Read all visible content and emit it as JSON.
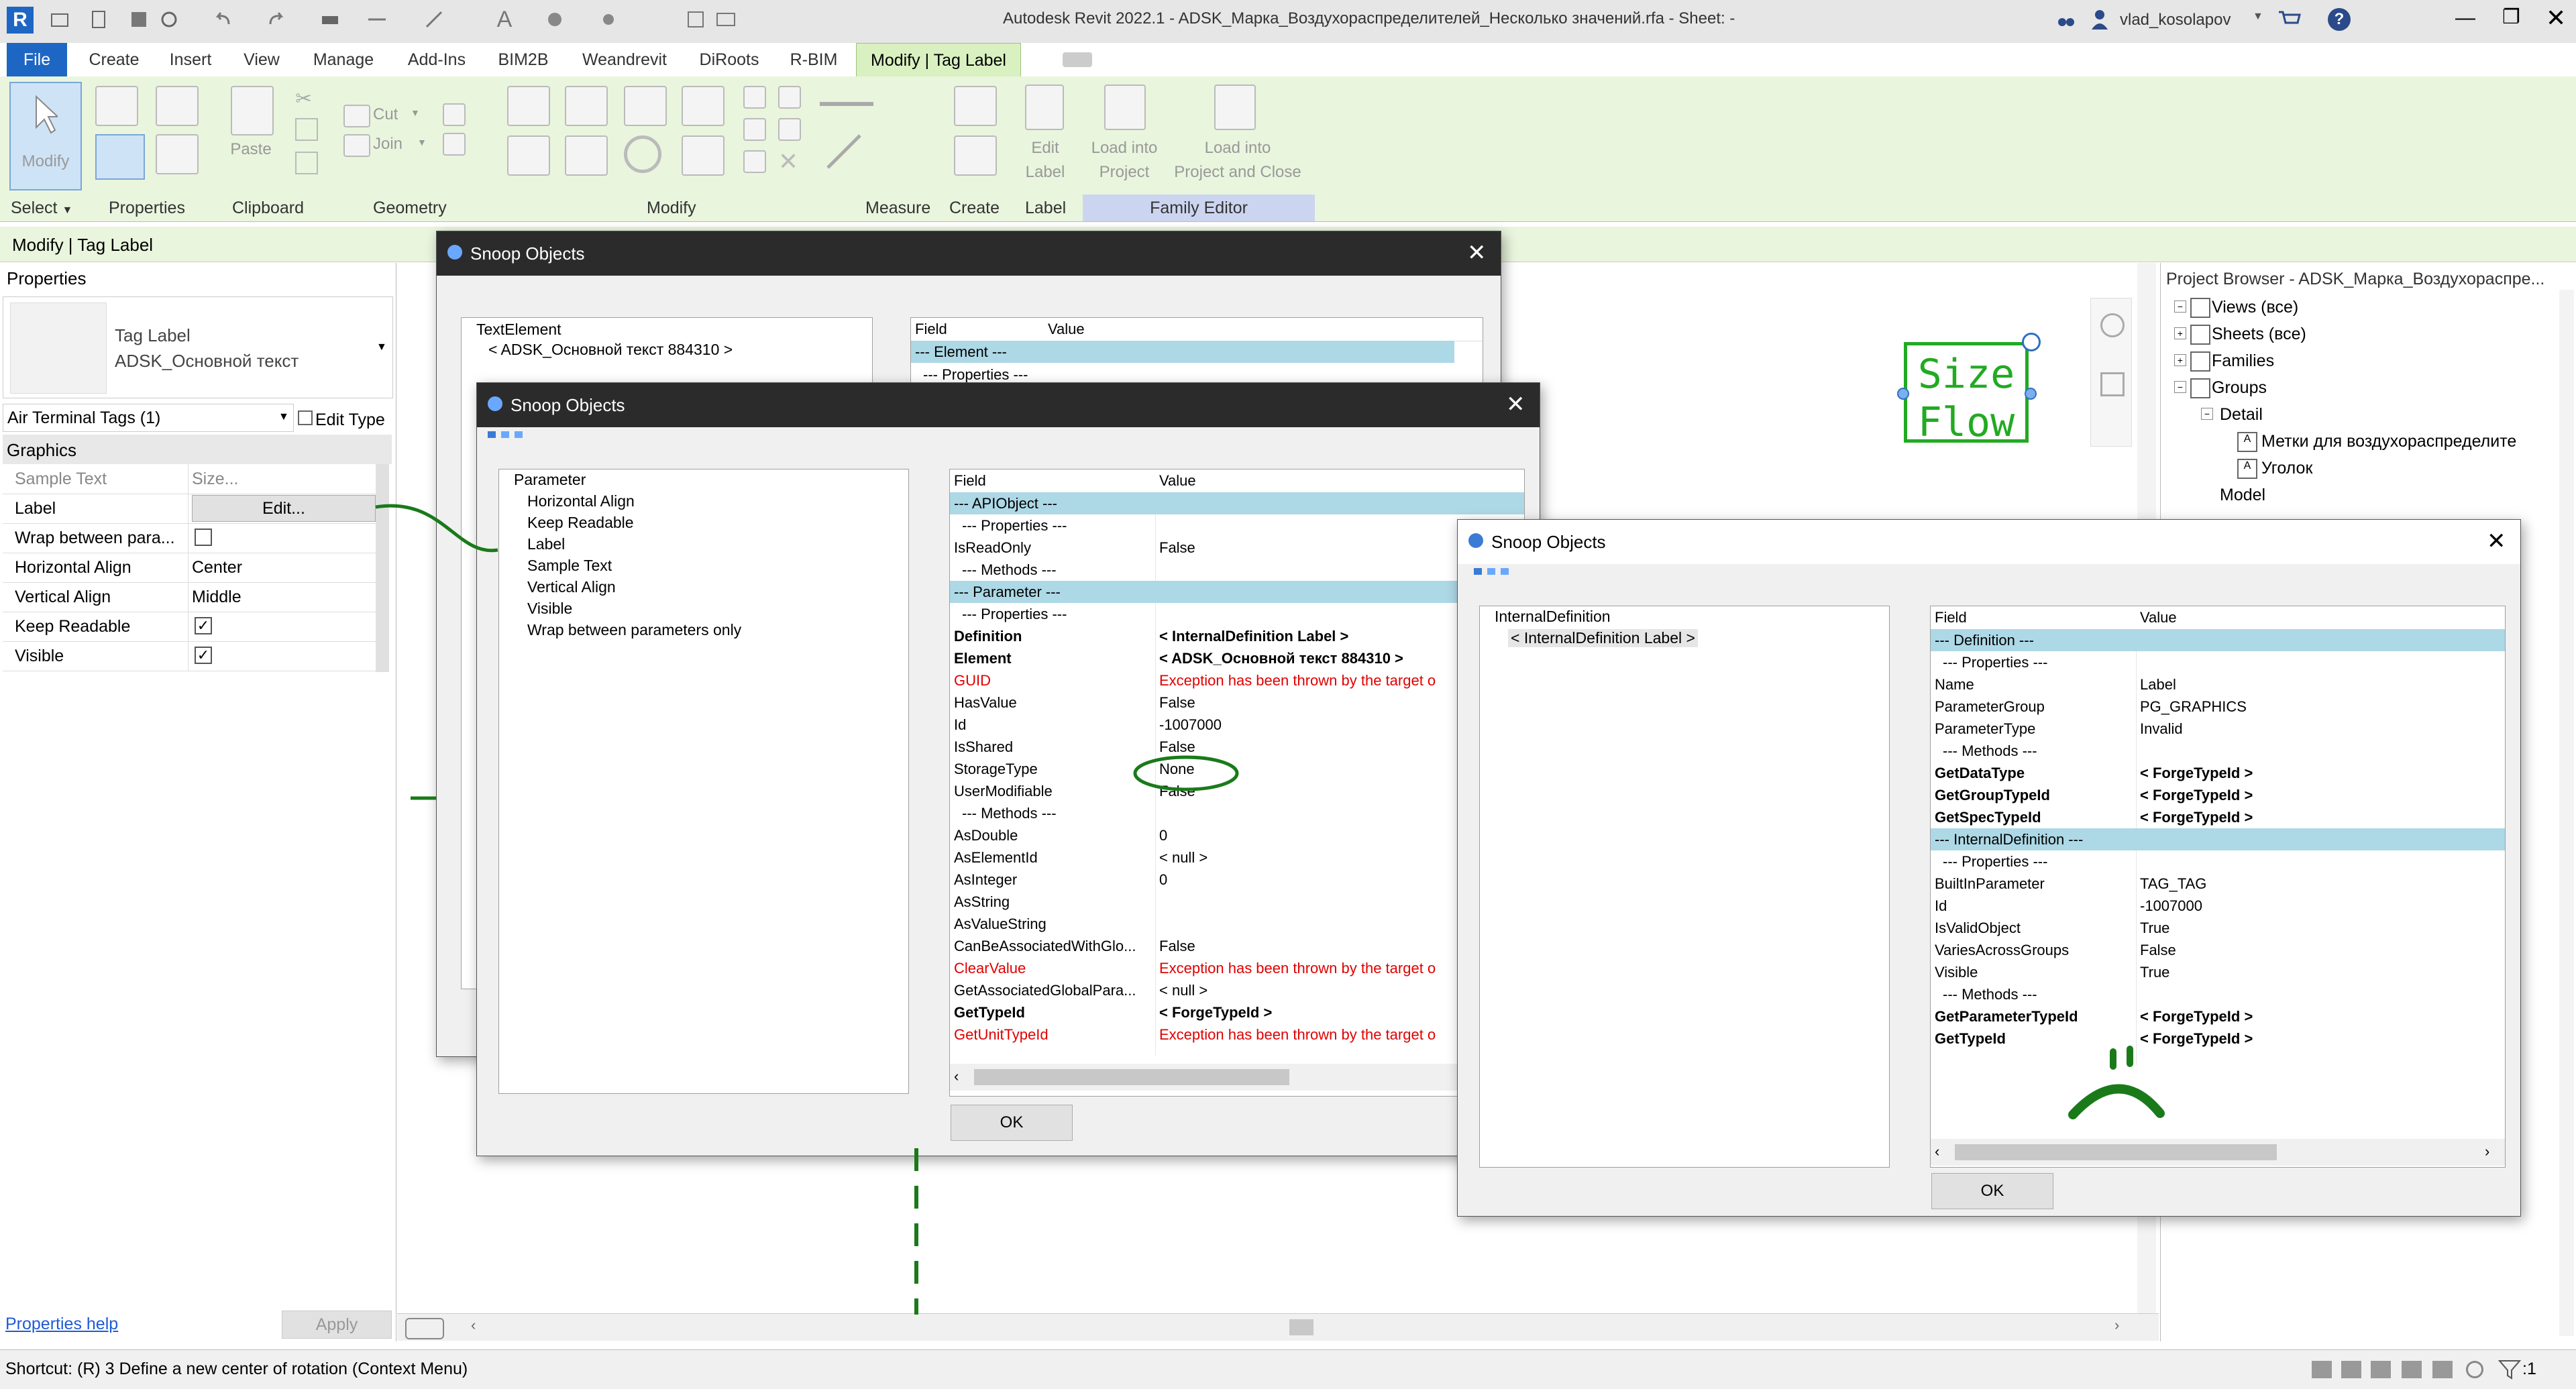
{
  "app": {
    "title": "Autodesk Revit 2022.1 - ADSK_Марка_Воздухораспределителей_Несколько значений.rfa - Sheet: -",
    "user": "vlad_kosolapov"
  },
  "ribbon": {
    "tabs": [
      "File",
      "Create",
      "Insert",
      "View",
      "Manage",
      "Add-Ins",
      "BIM2B",
      "Weandrevit",
      "DiRoots",
      "R-BIM",
      "Modify | Tag Label"
    ],
    "panels": {
      "select": "Select",
      "properties": "Properties",
      "clipboard": "Clipboard",
      "geometry": "Geometry",
      "modify": "Modify",
      "measure": "Measure",
      "create": "Create",
      "label": "Label",
      "family_editor": "Family Editor"
    },
    "buttons": {
      "modify": "Modify",
      "paste": "Paste",
      "cut": "Cut",
      "join": "Join",
      "edit_label_1": "Edit",
      "edit_label_2": "Label",
      "load_into_1": "Load into",
      "load_into_2": "Project",
      "load_close_1": "Load into",
      "load_close_2": "Project and Close"
    }
  },
  "options_bar": {
    "context": "Modify | Tag Label"
  },
  "properties": {
    "header": "Properties",
    "type_name_1": "Tag Label",
    "type_name_2": "ADSK_Основной текст",
    "filter": "Air Terminal Tags (1)",
    "edit_type": "Edit Type",
    "group": "Graphics",
    "rows": [
      {
        "key": "Sample Text",
        "value": "Size..."
      },
      {
        "key": "Label",
        "value": "Edit..."
      },
      {
        "key": "Wrap between para...",
        "value": ""
      },
      {
        "key": "Horizontal Align",
        "value": "Center"
      },
      {
        "key": "Vertical Align",
        "value": "Middle"
      },
      {
        "key": "Keep Readable",
        "value": ""
      },
      {
        "key": "Visible",
        "value": ""
      }
    ],
    "checks": {
      "wrap": false,
      "keep_readable": true,
      "visible": true
    },
    "help": "Properties help",
    "apply": "Apply"
  },
  "canvas": {
    "tag_line1": "Size",
    "tag_line2": "Flow"
  },
  "project_browser": {
    "title": "Project Browser - ADSK_Марка_Воздухораспре...",
    "items": [
      {
        "label": "Views (все)",
        "level": 0
      },
      {
        "label": "Sheets (все)",
        "level": 0
      },
      {
        "label": "Families",
        "level": 0
      },
      {
        "label": "Groups",
        "level": 0
      },
      {
        "label": "Detail",
        "level": 1
      },
      {
        "label": "Метки для воздухораспределите",
        "level": 2
      },
      {
        "label": "Уголок",
        "level": 2
      },
      {
        "label": "Model",
        "level": 1
      }
    ]
  },
  "status": {
    "text": "Shortcut: (R) 3 Define a new center of rotation (Context Menu)",
    "filter_count": ":1"
  },
  "snoop1": {
    "title": "Snoop Objects",
    "tree": [
      "TextElement",
      "< ADSK_Основной текст  884310 >"
    ],
    "headers": [
      "Field",
      "Value"
    ],
    "rows": [
      "--- Element ---",
      "--- Properties ---"
    ]
  },
  "snoop2": {
    "title": "Snoop Objects",
    "tree": [
      "Parameter",
      "Horizontal Align",
      "Keep Readable",
      "Label",
      "Sample Text",
      "Vertical Align",
      "Visible",
      "Wrap between parameters only"
    ],
    "headers": [
      "Field",
      "Value"
    ],
    "rows": [
      {
        "f": "--- APIObject ---",
        "v": "",
        "t": "sec"
      },
      {
        "f": "--- Properties ---",
        "v": "",
        "t": "sub"
      },
      {
        "f": "IsReadOnly",
        "v": "False",
        "t": ""
      },
      {
        "f": "--- Methods ---",
        "v": "",
        "t": "sub"
      },
      {
        "f": "--- Parameter ---",
        "v": "",
        "t": "sec"
      },
      {
        "f": "--- Properties ---",
        "v": "",
        "t": "sub"
      },
      {
        "f": "Definition",
        "v": "< InternalDefinition  Label >",
        "t": "b"
      },
      {
        "f": "Element",
        "v": "< ADSK_Основной текст  884310 >",
        "t": "b"
      },
      {
        "f": "GUID",
        "v": "Exception has been thrown by the target o",
        "t": "err"
      },
      {
        "f": "HasValue",
        "v": "False",
        "t": ""
      },
      {
        "f": "Id",
        "v": "-1007000",
        "t": ""
      },
      {
        "f": "IsShared",
        "v": "False",
        "t": ""
      },
      {
        "f": "StorageType",
        "v": "None",
        "t": ""
      },
      {
        "f": "UserModifiable",
        "v": "False",
        "t": ""
      },
      {
        "f": "--- Methods ---",
        "v": "",
        "t": "sub"
      },
      {
        "f": "AsDouble",
        "v": "0",
        "t": ""
      },
      {
        "f": "AsElementId",
        "v": "< null >",
        "t": ""
      },
      {
        "f": "AsInteger",
        "v": "0",
        "t": ""
      },
      {
        "f": "AsString",
        "v": "",
        "t": ""
      },
      {
        "f": "AsValueString",
        "v": "",
        "t": ""
      },
      {
        "f": "CanBeAssociatedWithGlo...",
        "v": "False",
        "t": ""
      },
      {
        "f": "ClearValue",
        "v": "Exception has been thrown by the target o",
        "t": "err"
      },
      {
        "f": "GetAssociatedGlobalPara...",
        "v": "< null >",
        "t": ""
      },
      {
        "f": "GetTypeId",
        "v": "< ForgeTypeId >",
        "t": "b"
      },
      {
        "f": "GetUnitTypeId",
        "v": "Exception has been thrown by the target o",
        "t": "err"
      }
    ],
    "ok": "OK"
  },
  "snoop3": {
    "title": "Snoop Objects",
    "tree": [
      "InternalDefinition",
      "< InternalDefinition  Label >"
    ],
    "headers": [
      "Field",
      "Value"
    ],
    "rows": [
      {
        "f": "--- Definition ---",
        "v": "",
        "t": "sec"
      },
      {
        "f": "--- Properties ---",
        "v": "",
        "t": "sub"
      },
      {
        "f": "Name",
        "v": "Label",
        "t": ""
      },
      {
        "f": "ParameterGroup",
        "v": "PG_GRAPHICS",
        "t": ""
      },
      {
        "f": "ParameterType",
        "v": "Invalid",
        "t": ""
      },
      {
        "f": "--- Methods ---",
        "v": "",
        "t": "sub"
      },
      {
        "f": "GetDataType",
        "v": "< ForgeTypeId >",
        "t": "b"
      },
      {
        "f": "GetGroupTypeId",
        "v": "< ForgeTypeId >",
        "t": "b"
      },
      {
        "f": "GetSpecTypeId",
        "v": "< ForgeTypeId >",
        "t": "b"
      },
      {
        "f": "--- InternalDefinition ---",
        "v": "",
        "t": "sec"
      },
      {
        "f": "--- Properties ---",
        "v": "",
        "t": "sub"
      },
      {
        "f": "BuiltInParameter",
        "v": "TAG_TAG",
        "t": ""
      },
      {
        "f": "Id",
        "v": "-1007000",
        "t": ""
      },
      {
        "f": "IsValidObject",
        "v": "True",
        "t": ""
      },
      {
        "f": "VariesAcrossGroups",
        "v": "False",
        "t": ""
      },
      {
        "f": "Visible",
        "v": "True",
        "t": ""
      },
      {
        "f": "--- Methods ---",
        "v": "",
        "t": "sub"
      },
      {
        "f": "GetParameterTypeId",
        "v": "< ForgeTypeId >",
        "t": "b"
      },
      {
        "f": "GetTypeId",
        "v": "< ForgeTypeId >",
        "t": "b"
      }
    ],
    "ok": "OK"
  },
  "colors": {
    "annotation_green": "#1a7a1a",
    "tag_green": "#22aa22",
    "file_tab": "#1e66c3",
    "section_row": "#add8e6"
  }
}
